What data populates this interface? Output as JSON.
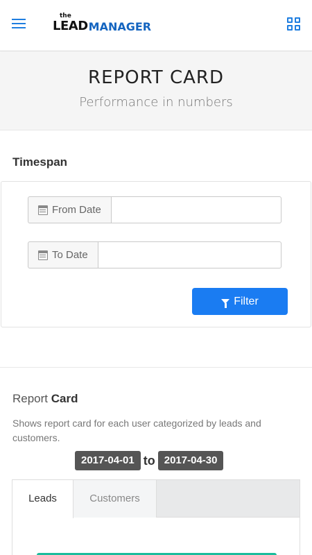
{
  "nav": {
    "logo_small": "the",
    "logo_lead": "LEAD",
    "logo_manager": "MANAGER"
  },
  "hero": {
    "title": "REPORT CARD",
    "subtitle": "Performance in numbers"
  },
  "timespan": {
    "heading": "Timespan",
    "from_label": "From Date",
    "from_value": "",
    "to_label": "To Date",
    "to_value": "",
    "filter_label": "Filter"
  },
  "report": {
    "title_light": "Report ",
    "title_bold": "Card",
    "description": "Shows report card for each user categorized by leads and customers.",
    "start_date": "2017-04-01",
    "to_word": "to",
    "end_date": "2017-04-30",
    "tabs": [
      {
        "label": "Leads",
        "active": true
      },
      {
        "label": "Customers",
        "active": false
      }
    ]
  },
  "colors": {
    "accent": "#1a7cf2",
    "brand_blue": "#1565c0",
    "badge": "#555555",
    "progress": "#1abc9c"
  },
  "icons": [
    "hamburger-menu-icon",
    "grid-apps-icon",
    "calendar-icon",
    "filter-icon"
  ]
}
